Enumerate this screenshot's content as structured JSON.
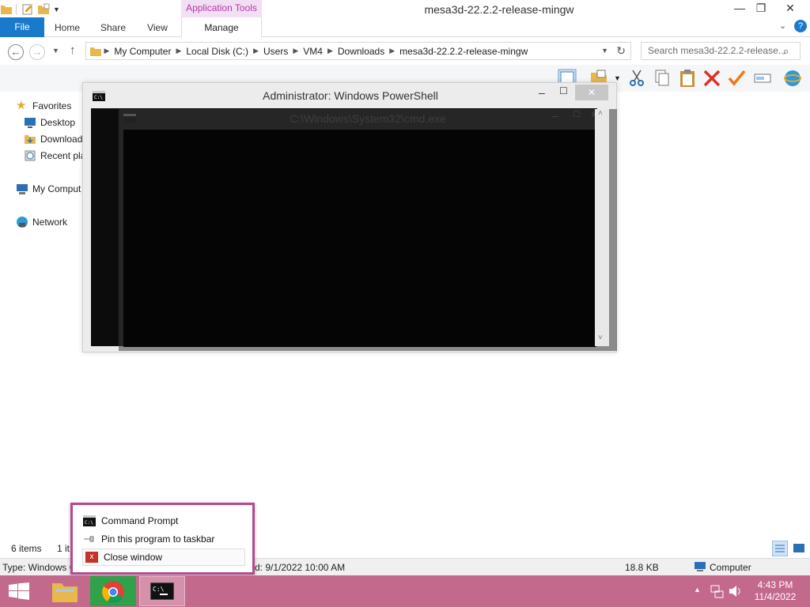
{
  "window": {
    "title": "mesa3d-22.2.2-release-mingw",
    "context_tab": "Application Tools",
    "minimize": "—",
    "maximize": "❐",
    "close": "✕"
  },
  "ribbon": {
    "tabs": [
      "File",
      "Home",
      "Share",
      "View",
      "Manage"
    ]
  },
  "address": {
    "crumbs": [
      "My Computer",
      "Local Disk (C:)",
      "Users",
      "VM4",
      "Downloads",
      "mesa3d-22.2.2-release-mingw"
    ],
    "search_placeholder": "Search mesa3d-22.2.2-release..."
  },
  "nav": {
    "favorites": "Favorites",
    "desktop": "Desktop",
    "downloads": "Download",
    "recent": "Recent pla",
    "computer": "My Comput",
    "network": "Network"
  },
  "powershell": {
    "title": "Administrator: Windows PowerShell",
    "close": "✕"
  },
  "cmd_ghost": {
    "title": "C:\\Windows\\System32\\cmd.exe"
  },
  "status": {
    "items_count": "6 items",
    "selected": "1 it",
    "type": "Type: Windows C",
    "date": "d: 9/1/2022 10:00 AM",
    "size": "18.8 KB",
    "location": "Computer"
  },
  "jumplist": {
    "items": [
      "Command Prompt",
      "Pin this program to taskbar",
      "Close window"
    ]
  },
  "clock": {
    "time": "4:43 PM",
    "date": "11/4/2022"
  },
  "colors": {
    "accent": "#1979ca",
    "taskbar": "#c3698b",
    "jumplist_border": "#b7478f"
  }
}
